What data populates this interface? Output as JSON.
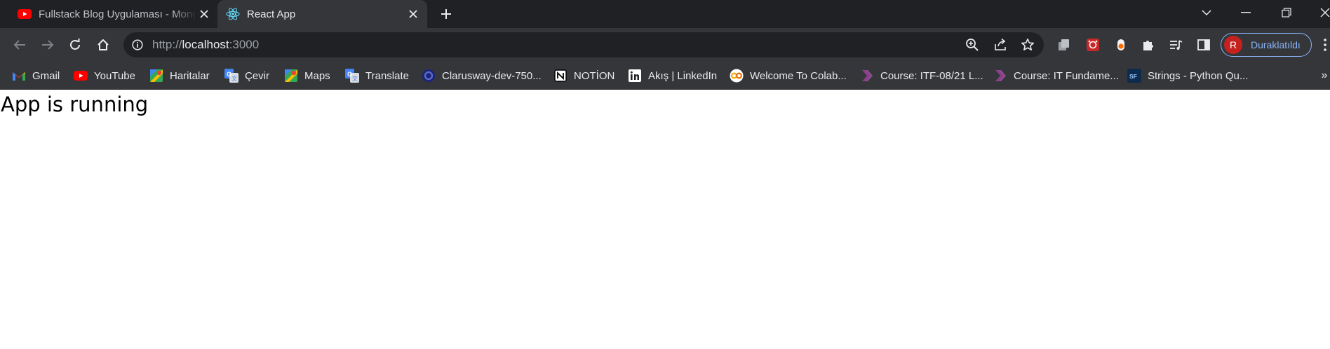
{
  "tabs": [
    {
      "title": "Fullstack Blog Uygulaması - Mongo",
      "favicon": "youtube-icon",
      "active": false
    },
    {
      "title": "React App",
      "favicon": "react-icon",
      "active": true
    }
  ],
  "toolbar": {
    "url_scheme": "http://",
    "url_host": "localhost",
    "url_port": ":3000",
    "profile_initial": "R",
    "profile_label": "Duraklatıldı"
  },
  "bookmarks": [
    {
      "label": "Gmail",
      "icon": "gmail-icon"
    },
    {
      "label": "YouTube",
      "icon": "youtube-icon"
    },
    {
      "label": "Haritalar",
      "icon": "maps-icon"
    },
    {
      "label": "Çevir",
      "icon": "translate-icon"
    },
    {
      "label": "Maps",
      "icon": "maps-icon"
    },
    {
      "label": "Translate",
      "icon": "translate-icon"
    },
    {
      "label": "Clarusway-dev-750...",
      "icon": "clarusway-icon"
    },
    {
      "label": "NOTİON",
      "icon": "notion-icon"
    },
    {
      "label": "Akış | LinkedIn",
      "icon": "linkedin-icon"
    },
    {
      "label": "Welcome To Colab...",
      "icon": "colab-icon"
    },
    {
      "label": "Course: ITF-08/21 L...",
      "icon": "course-icon"
    },
    {
      "label": "Course: IT Fundame...",
      "icon": "course-icon"
    },
    {
      "label": "Strings - Python Qu...",
      "icon": "sf-icon"
    }
  ],
  "bookmarks_overflow": "»",
  "page": {
    "message": "App is running"
  },
  "colors": {
    "tabstrip_bg": "#202124",
    "toolbar_bg": "#35363a",
    "omnibox_bg": "#202124",
    "accent": "#8ab4f8",
    "avatar_bg": "#c5221f"
  }
}
